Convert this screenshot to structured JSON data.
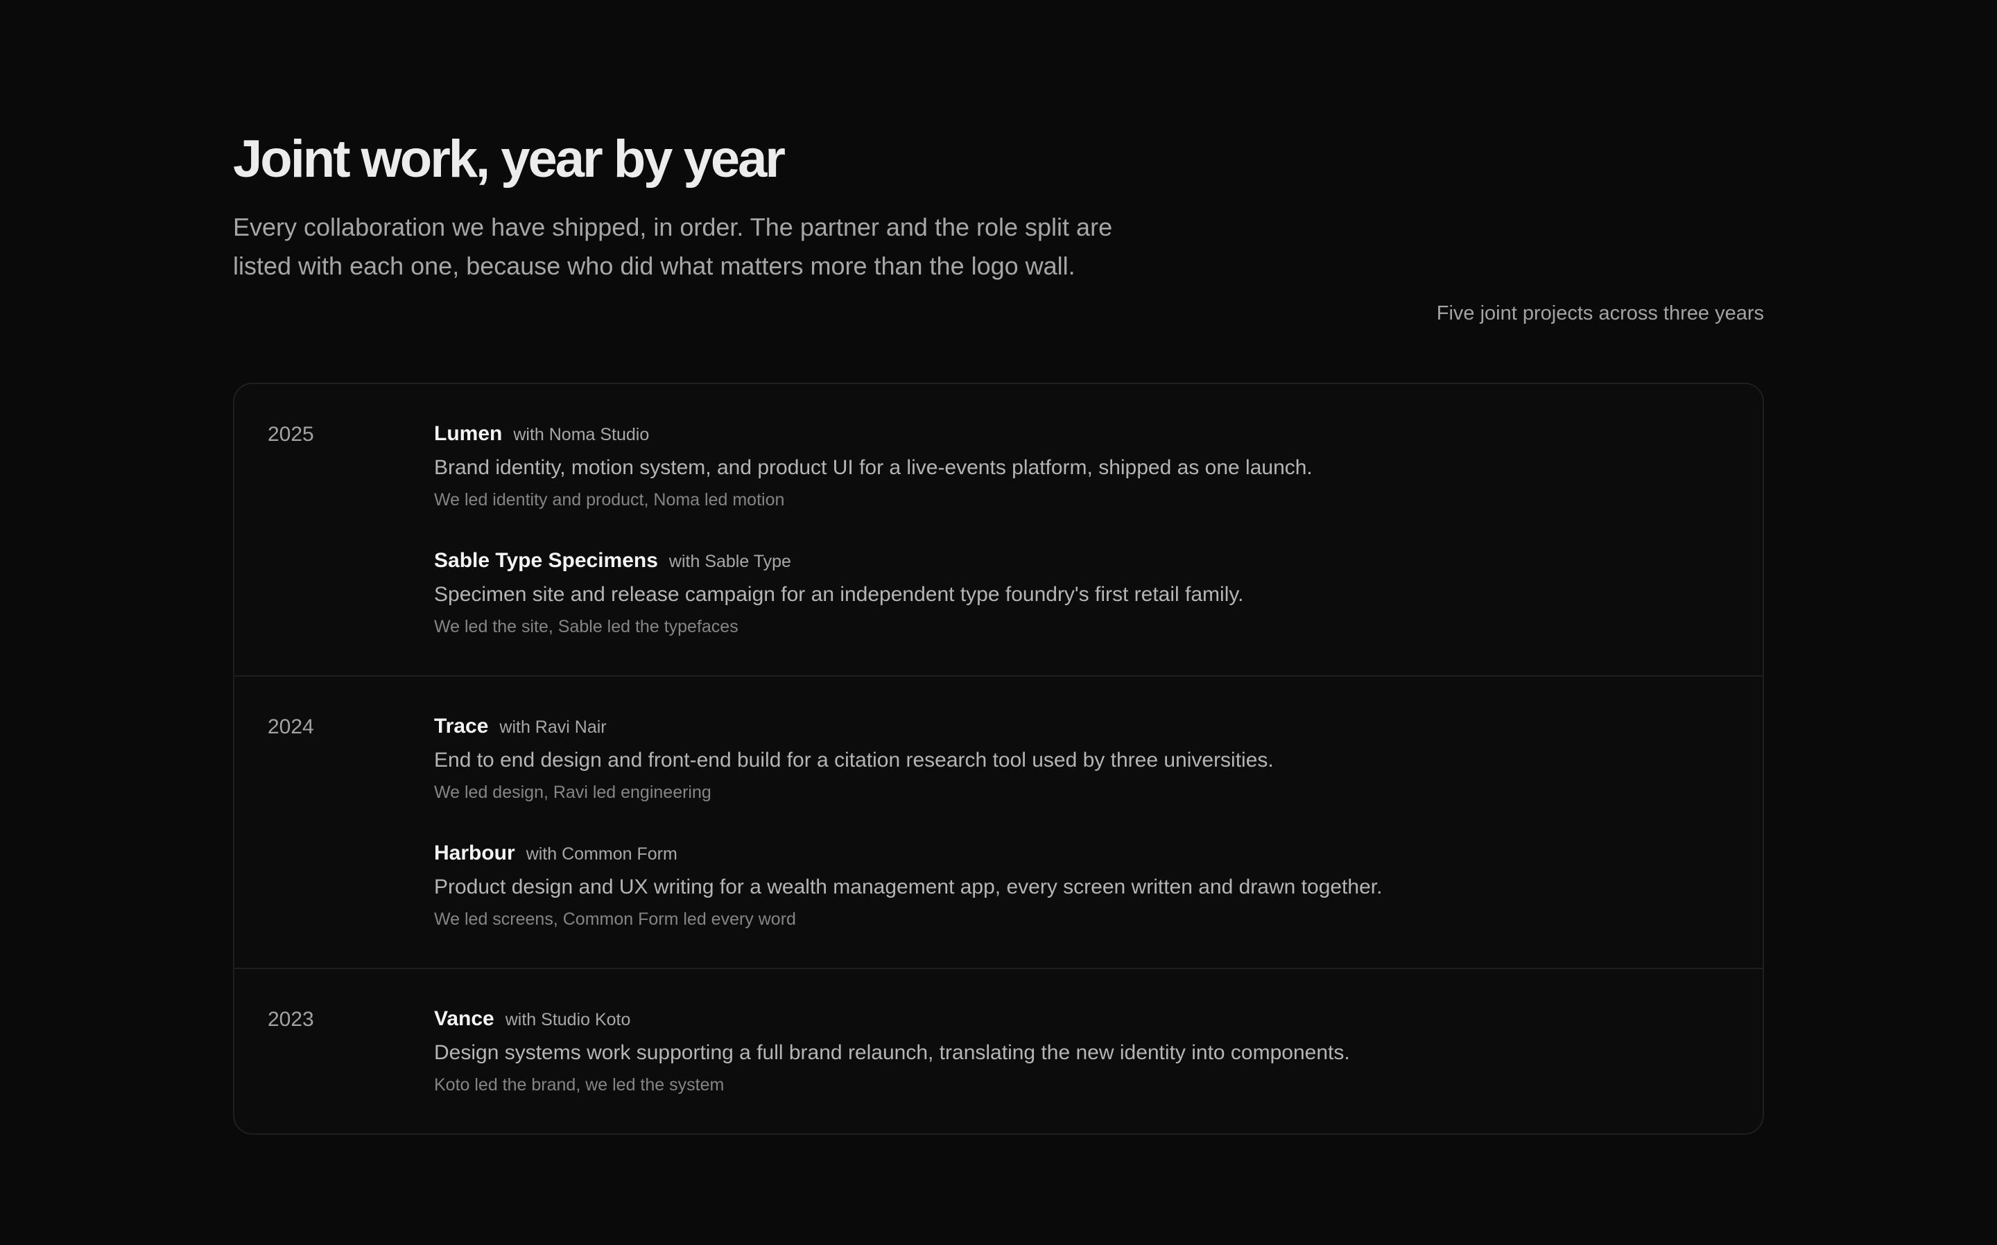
{
  "header": {
    "title": "Joint work, year by year",
    "intro": "Every collaboration we have shipped, in order. The partner and the role split are listed with each one, because who did what matters more than the logo wall.",
    "count_note": "Five joint projects across three years"
  },
  "timeline": {
    "years": [
      {
        "year": "2025",
        "projects": [
          {
            "name": "Lumen",
            "partner": "with Noma Studio",
            "description": "Brand identity, motion system, and product UI for a live-events platform, shipped as one launch.",
            "roles": "We led identity and product, Noma led motion"
          },
          {
            "name": "Sable Type Specimens",
            "partner": "with Sable Type",
            "description": "Specimen site and release campaign for an independent type foundry's first retail family.",
            "roles": "We led the site, Sable led the typefaces"
          }
        ]
      },
      {
        "year": "2024",
        "projects": [
          {
            "name": "Trace",
            "partner": "with Ravi Nair",
            "description": "End to end design and front-end build for a citation research tool used by three universities.",
            "roles": "We led design, Ravi led engineering"
          },
          {
            "name": "Harbour",
            "partner": "with Common Form",
            "description": "Product design and UX writing for a wealth management app, every screen written and drawn together.",
            "roles": "We led screens, Common Form led every word"
          }
        ]
      },
      {
        "year": "2023",
        "projects": [
          {
            "name": "Vance",
            "partner": "with Studio Koto",
            "description": "Design systems work supporting a full brand relaunch, translating the new identity into components.",
            "roles": "Koto led the brand, we led the system"
          }
        ]
      }
    ]
  }
}
